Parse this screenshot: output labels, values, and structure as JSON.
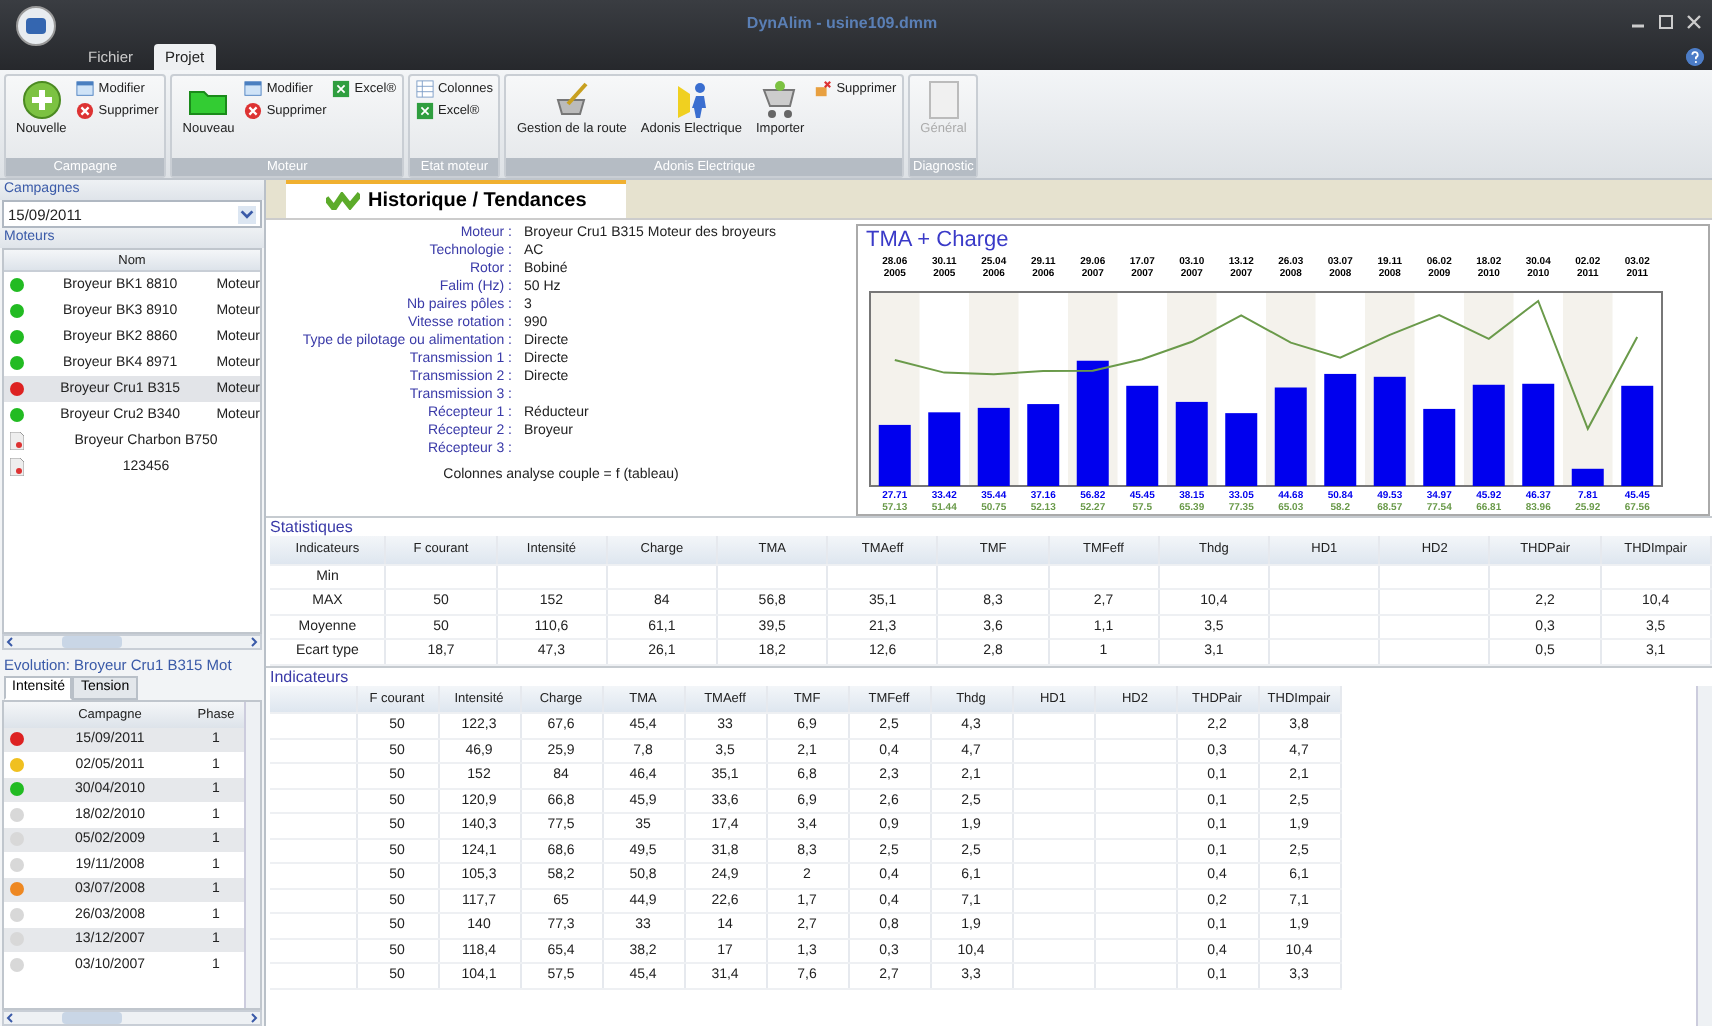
{
  "window": {
    "title": "DynAlim - usine109.dmm"
  },
  "menu_tabs": [
    {
      "label": "Fichier",
      "selected": false
    },
    {
      "label": "Projet",
      "selected": true
    }
  ],
  "ribbon": [
    {
      "label": "Campagne",
      "buttons": [
        {
          "label": "Nouvelle",
          "kind": "large",
          "disabled": false
        },
        {
          "label": "Modifier",
          "kind": "small",
          "disabled": false
        },
        {
          "label": "Supprimer",
          "kind": "small",
          "disabled": false
        }
      ]
    },
    {
      "label": "Moteur",
      "buttons": [
        {
          "label": "Nouveau",
          "kind": "large",
          "disabled": false
        },
        {
          "label": "Modifier",
          "kind": "small",
          "disabled": false
        },
        {
          "label": "Supprimer",
          "kind": "small",
          "disabled": false
        },
        {
          "label": "Excel®",
          "kind": "small",
          "disabled": false
        }
      ]
    },
    {
      "label": "Etat moteur",
      "buttons": [
        {
          "label": "Colonnes",
          "kind": "small",
          "disabled": false
        },
        {
          "label": "Excel®",
          "kind": "small",
          "disabled": false
        }
      ]
    },
    {
      "label": "Adonis Electrique",
      "buttons": [
        {
          "label": "Gestion de la route",
          "kind": "large",
          "disabled": false
        },
        {
          "label": "Adonis Electrique",
          "kind": "large",
          "disabled": false
        },
        {
          "label": "Importer",
          "kind": "large",
          "disabled": false
        },
        {
          "label": "Supprimer",
          "kind": "small",
          "disabled": false
        }
      ]
    },
    {
      "label": "Diagnostic",
      "buttons": [
        {
          "label": "Général",
          "kind": "large",
          "disabled": true
        }
      ]
    }
  ],
  "campagnes": {
    "header": "Campagnes",
    "value": "15/09/2011"
  },
  "moteurs": {
    "header": "Moteurs",
    "column": "Nom",
    "rows": [
      {
        "name": "Broyeur BK1 8810",
        "desc": "Moteur",
        "kind": "dot",
        "color": "#22bb22",
        "selected": false
      },
      {
        "name": "Broyeur BK3 8910",
        "desc": "Moteur",
        "kind": "dot",
        "color": "#22bb22",
        "selected": false
      },
      {
        "name": "Broyeur BK2 8860",
        "desc": "Moteur",
        "kind": "dot",
        "color": "#22bb22",
        "selected": false
      },
      {
        "name": "Broyeur BK4 8971",
        "desc": "Moteur",
        "kind": "dot",
        "color": "#22bb22",
        "selected": false
      },
      {
        "name": "Broyeur Cru1 B315",
        "desc": "Moteur",
        "kind": "dot",
        "color": "#dd2222",
        "selected": true
      },
      {
        "name": "Broyeur Cru2 B340",
        "desc": "Moteur",
        "kind": "dot",
        "color": "#22bb22",
        "selected": false
      },
      {
        "name": "Broyeur Charbon B750",
        "kind": "file",
        "selected": false
      },
      {
        "name": "123456",
        "kind": "file",
        "selected": false
      }
    ]
  },
  "evolution": {
    "title": "Evolution: Broyeur Cru1 B315  Mot",
    "tabs": [
      {
        "label": "Intensité",
        "selected": true
      },
      {
        "label": "Tension",
        "selected": false
      }
    ],
    "columns": [
      "Campagne",
      "Phase"
    ],
    "rows": [
      {
        "date": "15/09/2011",
        "phase": "1",
        "color": "#dd2222"
      },
      {
        "date": "02/05/2011",
        "phase": "1",
        "color": "#f0c020"
      },
      {
        "date": "30/04/2010",
        "phase": "1",
        "color": "#22bb22"
      },
      {
        "date": "18/02/2010",
        "phase": "1",
        "color": "#d8d8d8"
      },
      {
        "date": "05/02/2009",
        "phase": "1",
        "color": "#d8d8d8"
      },
      {
        "date": "19/11/2008",
        "phase": "1",
        "color": "#d8d8d8"
      },
      {
        "date": "03/07/2008",
        "phase": "1",
        "color": "#ee8822"
      },
      {
        "date": "26/03/2008",
        "phase": "1",
        "color": "#d8d8d8"
      },
      {
        "date": "13/12/2007",
        "phase": "1",
        "color": "#d8d8d8"
      },
      {
        "date": "03/10/2007",
        "phase": "1",
        "color": "#d8d8d8"
      }
    ]
  },
  "main_tab": {
    "label": "Historique / Tendances",
    "selected": true
  },
  "motor_info": {
    "fields": [
      {
        "label": "Moteur :",
        "value": "Broyeur Cru1 B315   Moteur des broyeurs"
      },
      {
        "label": "Technologie :",
        "value": "AC"
      },
      {
        "label": "Rotor :",
        "value": "Bobiné"
      },
      {
        "label": "Falim (Hz) :",
        "value": "50 Hz"
      },
      {
        "label": "Nb paires pôles :",
        "value": "3"
      },
      {
        "label": "Vitesse rotation :",
        "value": "990"
      },
      {
        "label": "Type de pilotage ou alimentation :",
        "value": "Directe"
      },
      {
        "label": "Transmission 1 :",
        "value": "Directe"
      },
      {
        "label": "Transmission 2 :",
        "value": "Directe"
      },
      {
        "label": "Transmission 3 :"
      },
      {
        "label": "Récepteur 1 :",
        "value": "Réducteur"
      },
      {
        "label": "Récepteur 2 :",
        "value": "Broyeur"
      },
      {
        "label": "Récepteur 3 :"
      }
    ],
    "footer": "Colonnes analyse couple = f (tableau)"
  },
  "chart": {
    "chart_data": {
      "type": "bar",
      "title": "TMA + Charge",
      "categories": [
        "28.06 2005",
        "30.11 2005",
        "25.04 2006",
        "29.11 2006",
        "29.06 2007",
        "17.07 2007",
        "03.10 2007",
        "13.12 2007",
        "26.03 2008",
        "03.07 2008",
        "19.11 2008",
        "06.02 2009",
        "18.02 2010",
        "30.04 2010",
        "02.02 2011",
        "03.02 2011"
      ],
      "series": [
        {
          "color": "#0000ee",
          "values": [
            27.71,
            33.42,
            35.44,
            37.16,
            56.82,
            45.45,
            38.15,
            33.05,
            44.68,
            50.84,
            49.53,
            34.97,
            45.92,
            46.37,
            7.81,
            45.45
          ]
        },
        {
          "type": "line",
          "color": "#6a9a4a",
          "values": [
            57.13,
            51.44,
            50.75,
            52.13,
            52.27,
            57.5,
            65.39,
            77.35,
            65.03,
            58.2,
            68.57,
            77.54,
            66.81,
            83.96,
            25.92,
            67.56
          ]
        }
      ],
      "data_labels": true
    }
  },
  "statistiques": {
    "title": "Statistiques",
    "columns": [
      "Indicateurs",
      "F courant",
      "Intensité",
      "Charge",
      "TMA",
      "TMAeff",
      "TMF",
      "TMFeff",
      "Thdg",
      "HD1",
      "HD2",
      "THDPair",
      "THDImpair"
    ],
    "rows": [
      [
        "Min",
        "",
        "",
        "",
        "",
        "",
        "",
        "",
        "",
        "",
        "",
        "",
        ""
      ],
      [
        "MAX",
        "50",
        "152",
        "84",
        "56,8",
        "35,1",
        "8,3",
        "2,7",
        "10,4",
        "",
        "",
        "2,2",
        "10,4"
      ],
      [
        "Moyenne",
        "50",
        "110,6",
        "61,1",
        "39,5",
        "21,3",
        "3,6",
        "1,1",
        "3,5",
        "",
        "",
        "0,3",
        "3,5"
      ],
      [
        "Ecart type",
        "18,7",
        "47,3",
        "26,1",
        "18,2",
        "12,6",
        "2,8",
        "1",
        "3,1",
        "",
        "",
        "0,5",
        "3,1"
      ]
    ]
  },
  "indicateurs": {
    "title": "Indicateurs",
    "columns": [
      "",
      "F courant",
      "Intensité",
      "Charge",
      "TMA",
      "TMAeff",
      "TMF",
      "TMFeff",
      "Thdg",
      "HD1",
      "HD2",
      "THDPair",
      "THDImpair"
    ],
    "rows": [
      [
        "",
        "50",
        "122,3",
        "67,6",
        "45,4",
        "33",
        "6,9",
        "2,5",
        "4,3",
        "",
        "",
        "2,2",
        "3,8"
      ],
      [
        "",
        "50",
        "46,9",
        "25,9",
        "7,8",
        "3,5",
        "2,1",
        "0,4",
        "4,7",
        "",
        "",
        "0,3",
        "4,7"
      ],
      [
        "",
        "50",
        "152",
        "84",
        "46,4",
        "35,1",
        "6,8",
        "2,3",
        "2,1",
        "",
        "",
        "0,1",
        "2,1"
      ],
      [
        "",
        "50",
        "120,9",
        "66,8",
        "45,9",
        "33,6",
        "6,9",
        "2,6",
        "2,5",
        "",
        "",
        "0,1",
        "2,5"
      ],
      [
        "",
        "50",
        "140,3",
        "77,5",
        "35",
        "17,4",
        "3,4",
        "0,9",
        "1,9",
        "",
        "",
        "0,1",
        "1,9"
      ],
      [
        "",
        "50",
        "124,1",
        "68,6",
        "49,5",
        "31,8",
        "8,3",
        "2,5",
        "2,5",
        "",
        "",
        "0,1",
        "2,5"
      ],
      [
        "",
        "50",
        "105,3",
        "58,2",
        "50,8",
        "24,9",
        "2",
        "0,4",
        "6,1",
        "",
        "",
        "0,4",
        "6,1"
      ],
      [
        "",
        "50",
        "117,7",
        "65",
        "44,9",
        "22,6",
        "1,7",
        "0,4",
        "7,1",
        "",
        "",
        "0,2",
        "7,1"
      ],
      [
        "",
        "50",
        "140",
        "77,3",
        "33",
        "14",
        "2,7",
        "0,8",
        "1,9",
        "",
        "",
        "0,1",
        "1,9"
      ],
      [
        "",
        "50",
        "118,4",
        "65,4",
        "38,2",
        "17",
        "1,3",
        "0,3",
        "10,4",
        "",
        "",
        "0,4",
        "10,4"
      ],
      [
        "",
        "50",
        "104,1",
        "57,5",
        "45,4",
        "31,4",
        "7,6",
        "2,7",
        "3,3",
        "",
        "",
        "0,1",
        "3,3"
      ]
    ]
  }
}
